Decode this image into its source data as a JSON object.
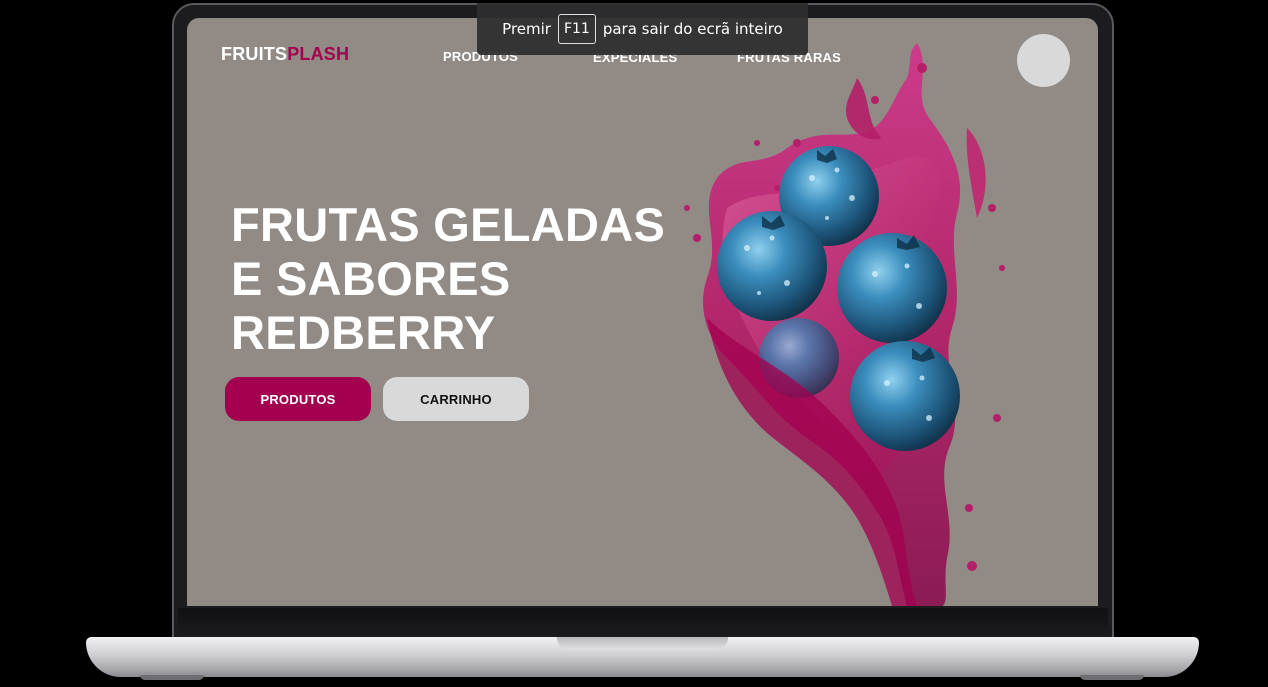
{
  "fullscreen_notice": {
    "prefix": "Premir",
    "key": "F11",
    "suffix": "para sair do ecrã inteiro"
  },
  "site": {
    "logo_part1": "FRUITS",
    "logo_part2": "PLASH",
    "nav": [
      {
        "label": "PRODUTOS"
      },
      {
        "label": "EXPECIALES"
      },
      {
        "label": "FRUTAS RARAS"
      }
    ],
    "hero": {
      "title_lines": [
        "FRUTAS GELADAS",
        "E SABORES",
        "REDBERRY"
      ],
      "primary_button": "PRODUTOS",
      "secondary_button": "CARRINHO"
    }
  },
  "colors": {
    "page_background": "#918a85",
    "accent": "#a3004f",
    "button_secondary": "#d9d9d9",
    "splash": "#c2206e",
    "berry": "#2f7aa7"
  },
  "icons": {
    "avatar": "user-avatar-circle",
    "hero_image": "blueberries-juice-splash"
  }
}
